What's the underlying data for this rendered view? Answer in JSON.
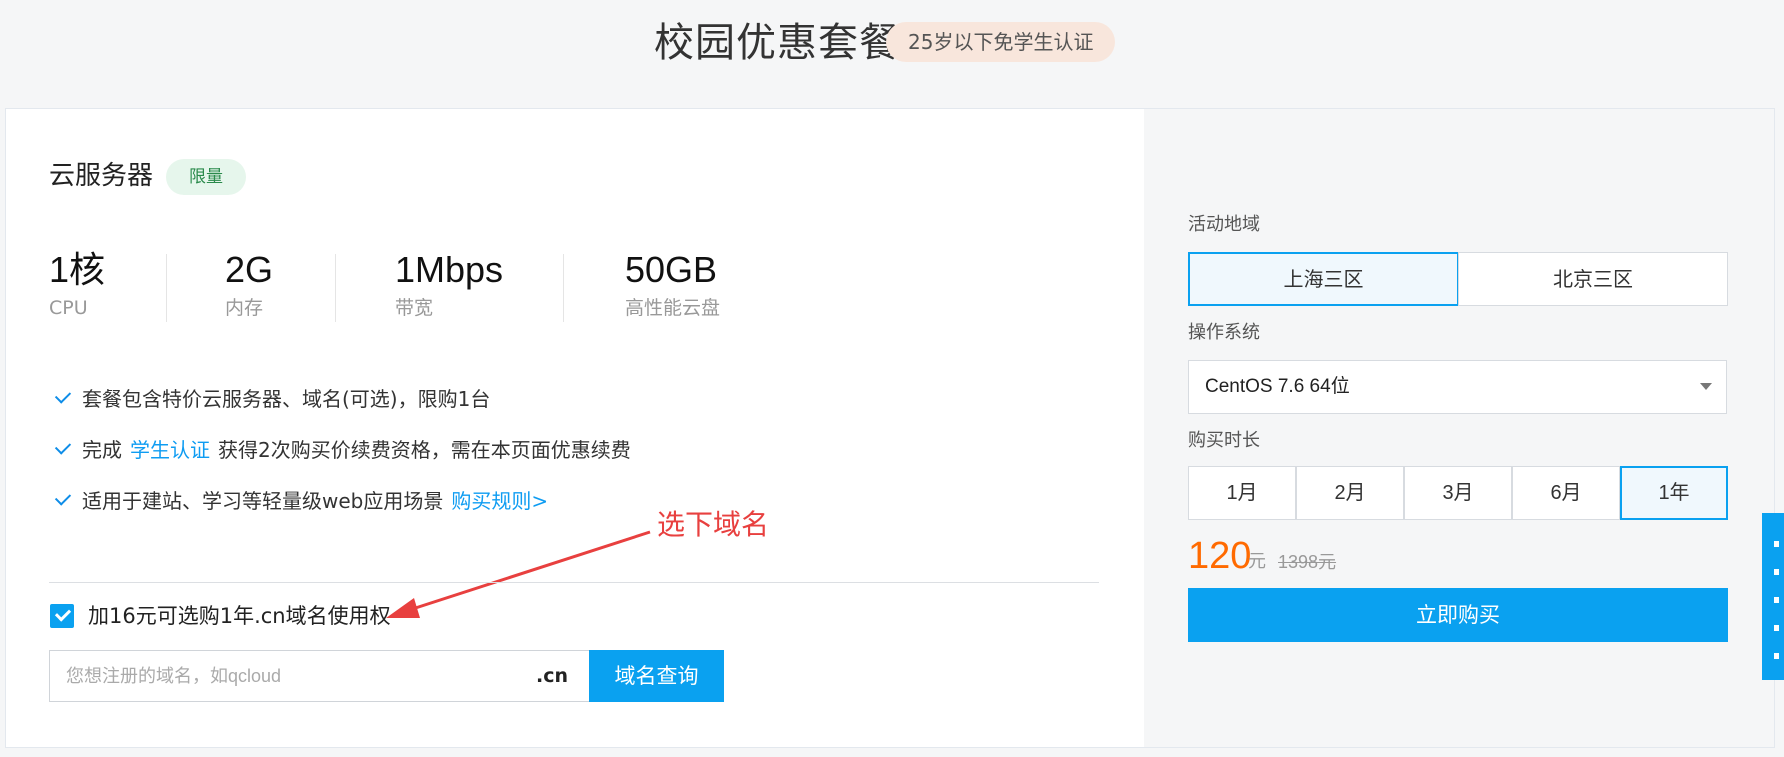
{
  "header": {
    "title": "校园优惠套餐",
    "badge": "25岁以下免学生认证"
  },
  "product": {
    "name": "云服务器",
    "tag": "限量",
    "specs": [
      {
        "value": "1核",
        "label": "CPU"
      },
      {
        "value": "2G",
        "label": "内存"
      },
      {
        "value": "1Mbps",
        "label": "带宽"
      },
      {
        "value": "50GB",
        "label": "高性能云盘"
      }
    ],
    "features": [
      {
        "text": "套餐包含特价云服务器、域名(可选)，限购1台"
      },
      {
        "prefix": "完成",
        "link": "学生认证",
        "suffix": "获得2次购买价续费资格，需在本页面优惠续费"
      },
      {
        "text": "适用于建站、学习等轻量级web应用场景",
        "link": "购买规则>"
      }
    ]
  },
  "annotation": {
    "text": "选下域名"
  },
  "domain": {
    "option_label": "加16元可选购1年.cn域名使用权",
    "input_placeholder": "您想注册的域名，如qcloud",
    "suffix": ".cn",
    "search_button": "域名查询"
  },
  "purchase": {
    "region_label": "活动地域",
    "regions": [
      "上海三区",
      "北京三区"
    ],
    "region_selected": "上海三区",
    "os_label": "操作系统",
    "os_value": "CentOS 7.6 64位",
    "duration_label": "购买时长",
    "durations": [
      "1月",
      "2月",
      "3月",
      "6月",
      "1年"
    ],
    "duration_selected": "1年",
    "price": "120",
    "price_unit": "元",
    "original_price": "1398元",
    "buy_button": "立即购买"
  },
  "colors": {
    "accent": "#0aa1f0",
    "price": "#ff6a00",
    "annotation": "#e8403f",
    "tag_green": "#2a8a4b"
  }
}
